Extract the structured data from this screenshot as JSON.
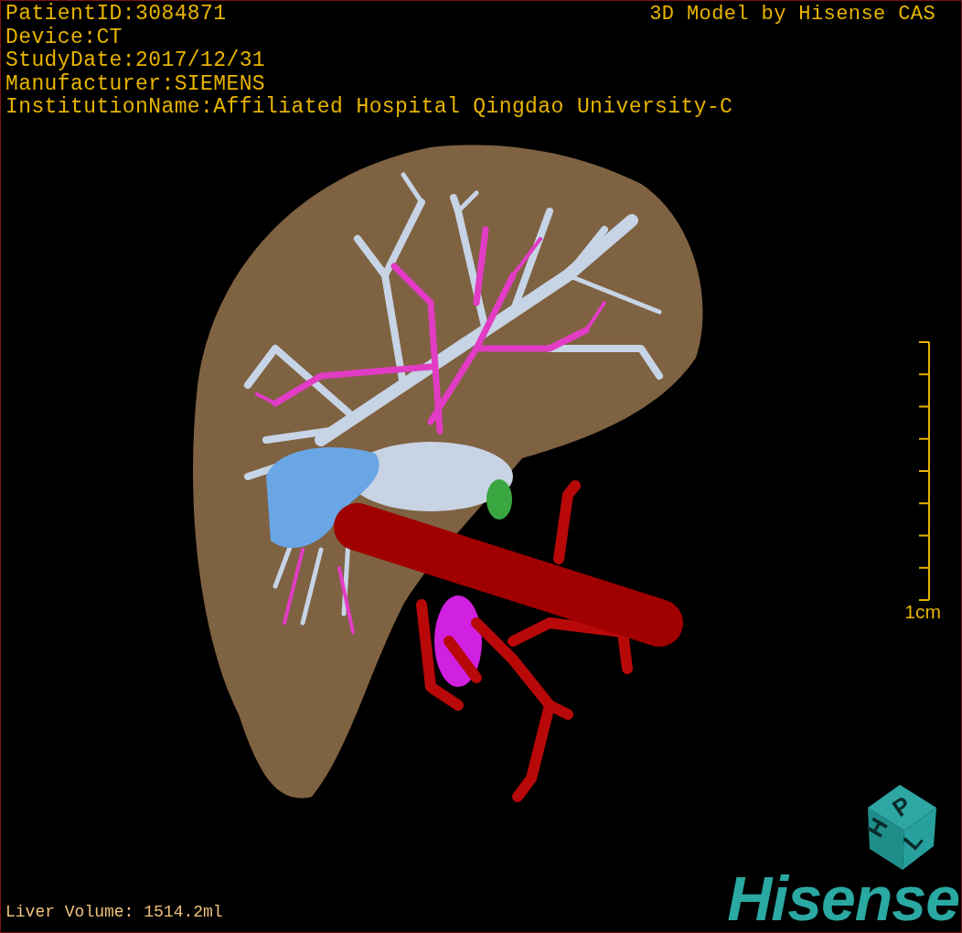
{
  "header": {
    "info_lines": [
      "PatientID:3084871",
      "Device:CT",
      "StudyDate:2017/12/31",
      "Manufacturer:SIEMENS",
      "InstitutionName:Affiliated Hospital Qingdao University-C"
    ],
    "credit": "3D Model by Hisense CAS"
  },
  "scale_bar": {
    "label": "1cm"
  },
  "orientation_cube": {
    "faces": [
      "H",
      "P",
      "L"
    ]
  },
  "footer": {
    "liver_volume": "Liver Volume: 1514.2ml",
    "logo": "Hisense"
  }
}
